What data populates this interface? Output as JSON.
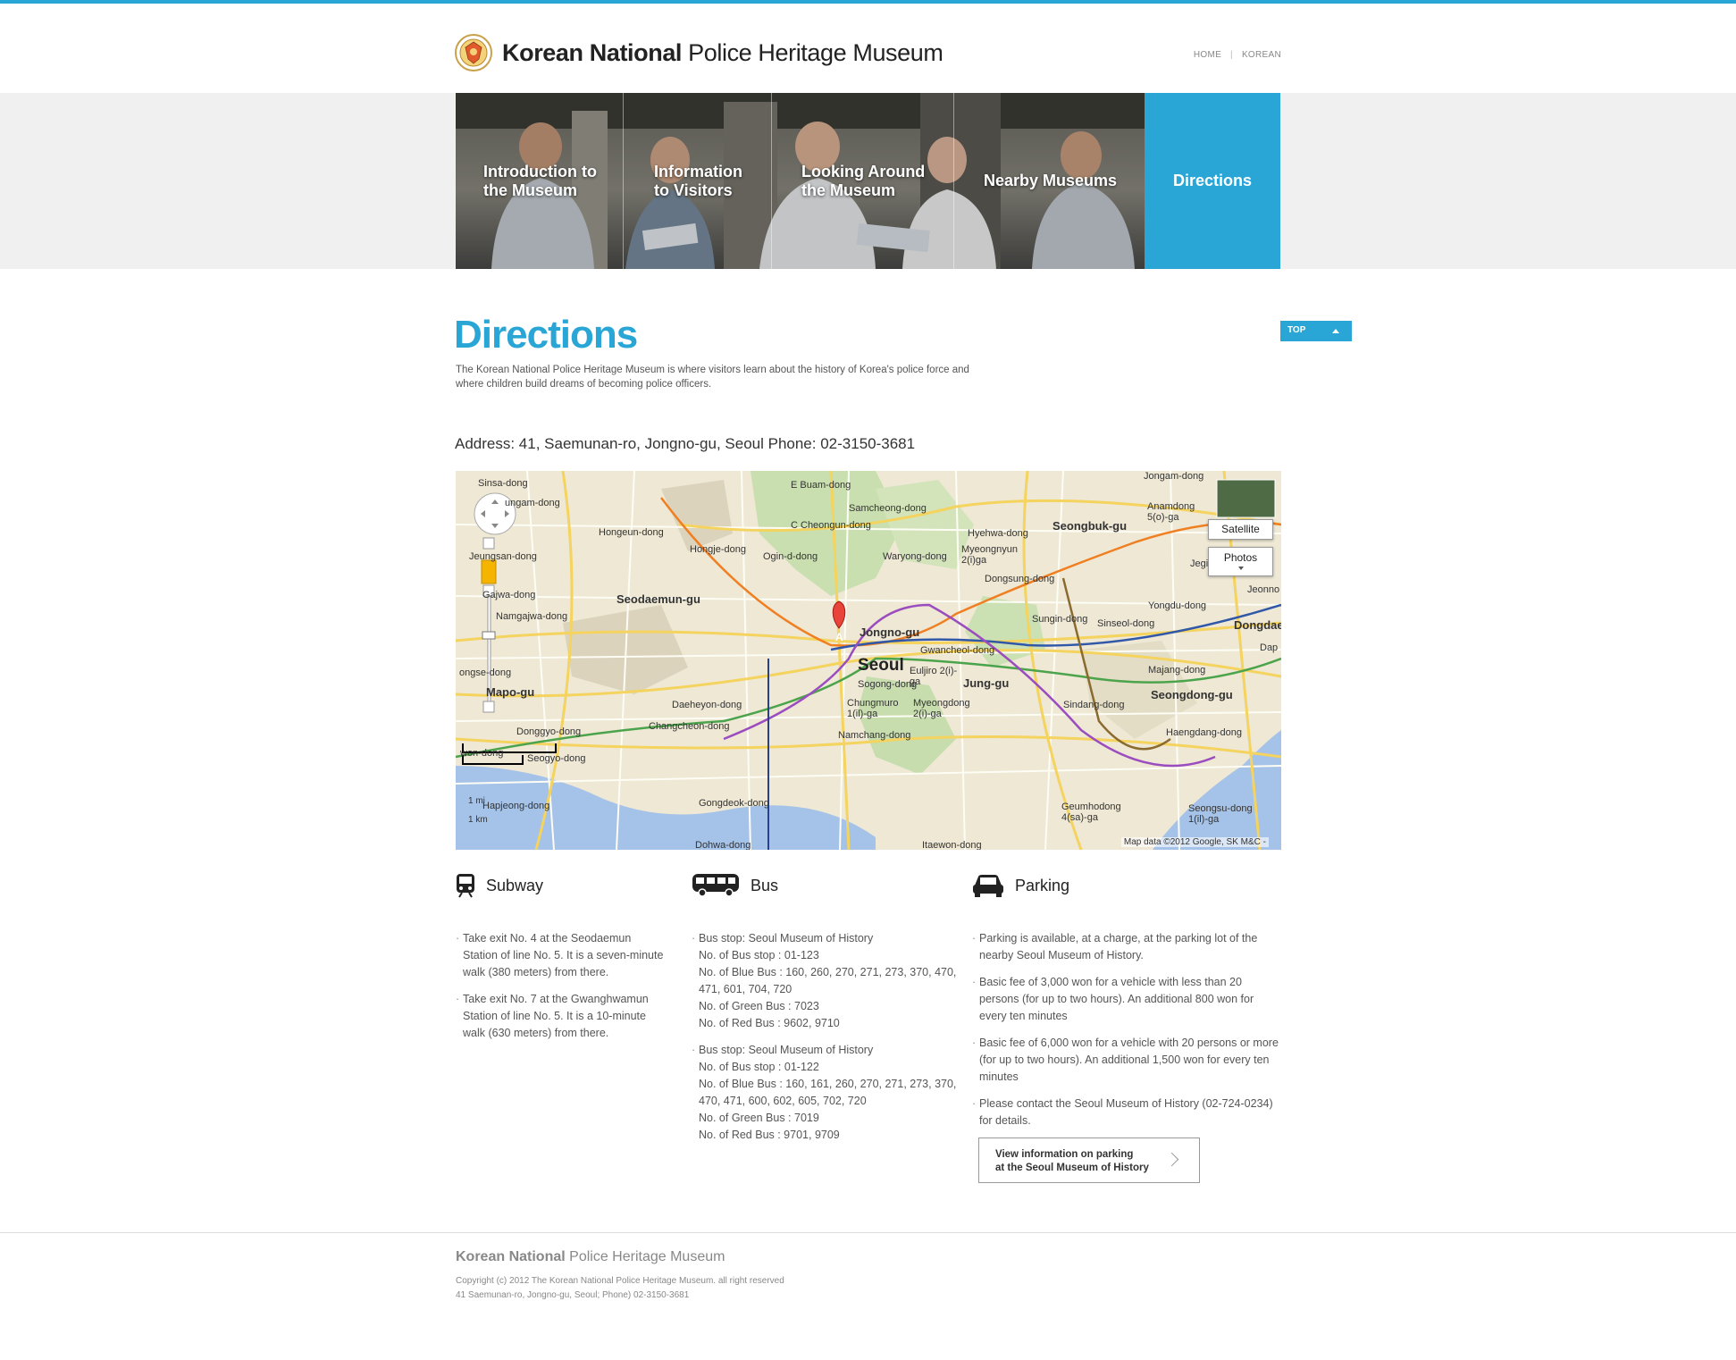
{
  "header": {
    "logo_bold": "Korean National",
    "logo_regular": "Police Heritage Museum",
    "links": [
      "HOME",
      "KOREAN"
    ]
  },
  "nav": {
    "items": [
      "Introduction to the Museum",
      "Information to Visitors",
      "Looking Around the Museum",
      "Nearby Museums",
      "Directions"
    ],
    "active": "Directions"
  },
  "main": {
    "title": "Directions",
    "intro": "The Korean National Police Heritage Museum is where visitors learn about the history of Korea's police force and where children build dreams of becoming police officers.",
    "top_button": "TOP",
    "address": "Address: 41, Saemunan-ro, Jongno-gu, Seoul  Phone: 02-3150-3681"
  },
  "map": {
    "labels": {
      "sinsa": "Sinsa-dong",
      "bukgak": "ungam-dong",
      "buam": "E Buam-dong",
      "hongeun": "Hongeun-dong",
      "hongje": "Hongje-dong",
      "ogin": "Ogin-d-dong",
      "samcheong": "Samcheong-dong",
      "cheongun": "C Cheongun-dong",
      "waryong": "Waryong-dong",
      "myeongnyun": "Myeongnyun 2(i)ga",
      "hyehwa": "Hyehwa-dong",
      "seongbuk": "Seongbuk-gu",
      "anamdong": "Anamdong 5(o)-ga",
      "jongam": "Jongam-dong",
      "jegi": "Jegi-dong",
      "jeonno": "Jeonno",
      "yeonnam": "Jeungsan-dong",
      "seodaemun": "Seodaemun-gu",
      "dongsung": "Dongsung-dong",
      "sungin": "Sungin-dong",
      "yongdu": "Yongdu-dong",
      "sinseol": "Sinseol-dong",
      "dongdaemun": "Dongdaemun-",
      "dap": "Dap",
      "gajwa": "Gajwa-dong",
      "namgajwa": "Namgajwa-dong",
      "jongno": "Jongno-gu",
      "gwancheol": "Gwancheol-dong",
      "seoul": "Seoul",
      "euljiro": "Euljiro 2(i)-ga",
      "junggu": "Jung-gu",
      "majang": "Majang-dong",
      "seongdong": "Seongdong-gu",
      "sogong": "Sogong-dong",
      "mapo": "Mapo-gu",
      "daeheyon": "Daeheyon-dong",
      "chungmuro": "Chungmuro 1(il)-ga",
      "myeongdong": "Myeongdong 2(i)-ga",
      "sindang": "Sindang-dong",
      "haengdang": "Haengdang-dong",
      "donggyo": "Donggyo-dong",
      "changcheon": "Changcheon-dong",
      "namchang": "Namchang-dong",
      "seogyo": "Seogyo-dong",
      "wondang": "won-dong",
      "hapjeong": "Hapjeong-dong",
      "gongdeok": "Gongdeok-dong",
      "geumhodong": "Geumhodong 4(sa)-ga",
      "seongsu": "Seongsu-dong 1(il)-ga",
      "itaewon": "Itaewon-dong",
      "dohwa": "Dohwa-dong",
      "ongse": "ongse-dong",
      "marker": "A"
    },
    "satellite": "Satellite",
    "photos": "Photos",
    "scale_mi": "1 mi",
    "scale_km": "1 km",
    "copyright": "Map data ©2012 Google, SK M&C -"
  },
  "subway": {
    "title": "Subway",
    "items": [
      "Take exit No. 4 at the Seodaemun Station of line No. 5. It is a seven-minute walk (380 meters) from there.",
      "Take exit No. 7 at the Gwanghwamun Station of line No. 5. It is a 10-minute walk (630 meters) from there."
    ]
  },
  "bus": {
    "title": "Bus",
    "stops": [
      {
        "name": "Bus stop: Seoul Museum of History",
        "stop_no": "No. of Bus stop :  01-123",
        "blue": "No. of Blue Bus : 160, 260, 270, 271, 273, 370, 470, 471, 601, 704, 720",
        "green": "No. of Green Bus : 7023",
        "red": "No. of Red Bus : 9602, 9710"
      },
      {
        "name": "Bus stop: Seoul Museum of History",
        "stop_no": "No. of Bus stop :  01-122",
        "blue": "No. of Blue Bus : 160, 161, 260, 270, 271, 273, 370, 470, 471, 600, 602, 605, 702, 720",
        "green": "No. of Green Bus : 7019",
        "red": "No. of Red Bus : 9701, 9709"
      }
    ]
  },
  "parking": {
    "title": "Parking",
    "items": [
      "Parking is available, at a charge, at the parking lot of the nearby Seoul Museum of History.",
      "Basic fee of 3,000 won for a vehicle with less than 20 persons (for up to two hours). An additional 800 won for every ten minutes",
      "Basic fee of 6,000 won for a vehicle with 20 persons or more (for up to two hours). An additional 1,500 won for every ten minutes",
      "Please contact the Seoul Museum of History (02-724-0234) for details."
    ],
    "button_line1": "View information on parking",
    "button_line2": "at the Seoul Museum of History"
  },
  "footer": {
    "logo_bold": "Korean National",
    "logo_regular": "Police Heritage Museum",
    "copyright": "Copyright (c) 2012 The Korean National Police Heritage Museum. all right reserved",
    "address": "41 Saemunan-ro, Jongno-gu, Seoul; Phone) 02-3150-3681"
  },
  "colors": {
    "accent": "#2aa6d6"
  }
}
